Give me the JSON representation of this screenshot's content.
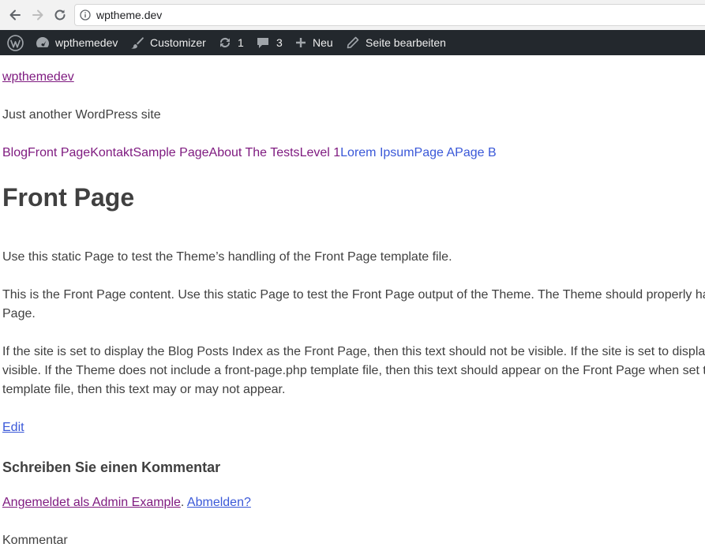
{
  "browser": {
    "url": "wptheme.dev"
  },
  "adminbar": {
    "site_name": "wpthemedev",
    "customizer": "Customizer",
    "updates_count": "1",
    "comments_count": "3",
    "new_label": "Neu",
    "edit_page": "Seite bearbeiten"
  },
  "site": {
    "title": "wpthemedev",
    "description": "Just another WordPress site"
  },
  "menu": [
    {
      "label": "Blog",
      "visited": true
    },
    {
      "label": "Front Page",
      "visited": true
    },
    {
      "label": "Kontakt",
      "visited": true
    },
    {
      "label": "Sample Page",
      "visited": true
    },
    {
      "label": "About The Tests",
      "visited": true
    },
    {
      "label": "Level 1",
      "visited": true
    },
    {
      "label": "Lorem Ipsum",
      "visited": false
    },
    {
      "label": "Page A",
      "visited": false
    },
    {
      "label": "Page B",
      "visited": false
    }
  ],
  "page": {
    "title": "Front Page",
    "paragraphs": [
      "Use this static Page to test the Theme’s handling of the Front Page template file.",
      "This is the Front Page content. Use this static Page to test the Front Page output of the Theme. The Theme should properly ha",
      "Page.",
      "If the site is set to display the Blog Posts Index as the Front Page, then this text should not be visible. If the site is set to displa",
      "visible. If the Theme does not include a front-page.php template file, then this text should appear on the Front Page when set t",
      "template file, then this text may or may not appear."
    ],
    "edit_link": "Edit"
  },
  "comments": {
    "title": "Schreiben Sie einen Kommentar",
    "logged_in_as": "Angemeldet als Admin Example",
    "separator": ".",
    "logout": "Abmelden?",
    "comment_label": "Kommentar"
  },
  "colors": {
    "adminbar_bg": "#23282d",
    "link": "#3a58d8",
    "link_visited": "#7f1b80",
    "text": "#404040"
  }
}
